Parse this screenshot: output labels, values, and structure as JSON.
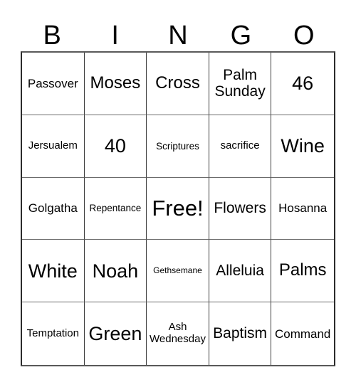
{
  "card": {
    "title": "Bingo Card",
    "background_color": "#ffffff",
    "text_color": "#000000",
    "border_color": "#3d3d3d",
    "columns": 5,
    "rows": 5
  },
  "header": {
    "letters": [
      {
        "label": "B"
      },
      {
        "label": "I"
      },
      {
        "label": "N"
      },
      {
        "label": "G"
      },
      {
        "label": "O"
      }
    ]
  },
  "grid": {
    "cells": [
      {
        "label": "Passover",
        "size": "sm",
        "free": false
      },
      {
        "label": "Moses",
        "size": "lg",
        "free": false
      },
      {
        "label": "Cross",
        "size": "lg",
        "free": false
      },
      {
        "label": "Palm Sunday",
        "size": "md",
        "free": false
      },
      {
        "label": "46",
        "size": "xl",
        "free": false
      },
      {
        "label": "Jersualem",
        "size": "xs",
        "free": false
      },
      {
        "label": "40",
        "size": "xl",
        "free": false
      },
      {
        "label": "Scriptures",
        "size": "xxs",
        "free": false
      },
      {
        "label": "sacrifice",
        "size": "xs",
        "free": false
      },
      {
        "label": "Wine",
        "size": "xl",
        "free": false
      },
      {
        "label": "Golgatha",
        "size": "sm",
        "free": false
      },
      {
        "label": "Repentance",
        "size": "xxs",
        "free": false
      },
      {
        "label": "Free!",
        "size": "xxl",
        "free": true
      },
      {
        "label": "Flowers",
        "size": "md",
        "free": false
      },
      {
        "label": "Hosanna",
        "size": "sm",
        "free": false
      },
      {
        "label": "White",
        "size": "xl",
        "free": false
      },
      {
        "label": "Noah",
        "size": "xl",
        "free": false
      },
      {
        "label": "Gethsemane",
        "size": "tiny",
        "free": false
      },
      {
        "label": "Alleluia",
        "size": "md",
        "free": false
      },
      {
        "label": "Palms",
        "size": "lg",
        "free": false
      },
      {
        "label": "Temptation",
        "size": "xs",
        "free": false
      },
      {
        "label": "Green",
        "size": "xl",
        "free": false
      },
      {
        "label": "Ash Wednesday",
        "size": "xs",
        "free": false
      },
      {
        "label": "Baptism",
        "size": "md",
        "free": false
      },
      {
        "label": "Command",
        "size": "sm",
        "free": false
      }
    ]
  }
}
